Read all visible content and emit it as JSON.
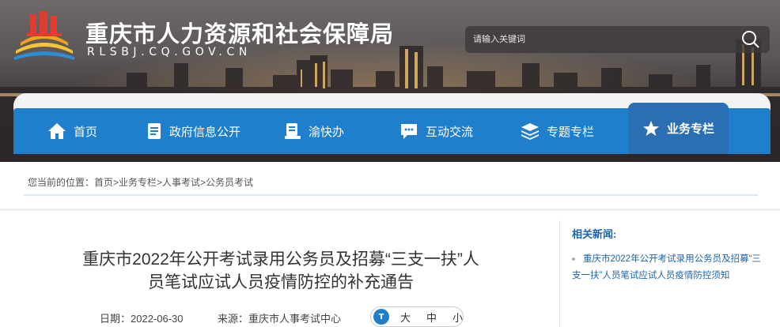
{
  "header": {
    "site_title": "重庆市人力资源和社会保障局",
    "site_domain": "RLSBJ.CQ.GOV.CN",
    "search_placeholder": "请输入关键词"
  },
  "nav": {
    "items": [
      {
        "label": "首页",
        "icon": "home-icon"
      },
      {
        "label": "政府信息公开",
        "icon": "document-icon"
      },
      {
        "label": "渝快办",
        "icon": "service-icon"
      },
      {
        "label": "互动交流",
        "icon": "chat-icon"
      },
      {
        "label": "专题专栏",
        "icon": "layers-icon"
      },
      {
        "label": "业务专栏",
        "icon": "star-icon"
      }
    ],
    "active_index": 5
  },
  "breadcrumb": {
    "prefix": "您当前的位置：",
    "path": "首页>业务专栏>人事考试>公务员考试"
  },
  "article": {
    "title_line1": "重庆市2022年公开考试录用公务员及招募“三支一扶”人",
    "title_line2": "员笔试应试人员疫情防控的补充通告",
    "date_label": "日期：2022-06-30",
    "source_label": "来源：重庆市人事考试中心",
    "font_size": {
      "icon_text": "T",
      "large": "大",
      "medium": "中",
      "small": "小"
    }
  },
  "related": {
    "heading": "相关新闻:",
    "items": [
      "重庆市2022年公开考试录用公务员及招募“三支一扶”人员笔试应试人员疫情防控须知"
    ]
  },
  "colors": {
    "nav_blue": "#1f7fcd",
    "nav_active": "#2a6fb4",
    "link_blue": "#1d64a8"
  }
}
